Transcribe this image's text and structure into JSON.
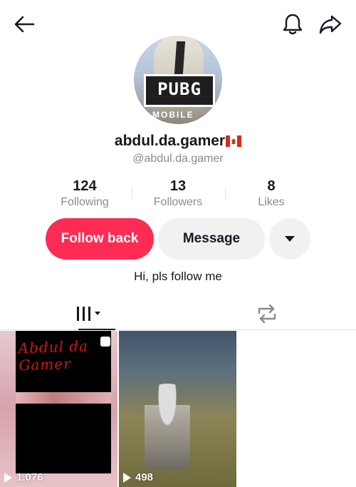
{
  "header": {
    "back_icon": "arrow-left-icon",
    "bell_icon": "bell-icon",
    "share_icon": "share-arrow-icon"
  },
  "profile": {
    "avatar_logo_text": "PUBG",
    "avatar_logo_sub": "MOBILE",
    "username": "abdul.da.gamer",
    "flag_icon": "canada-flag-icon",
    "handle": "@abdul.da.gamer",
    "bio": "Hi, pls follow me"
  },
  "stats": [
    {
      "value": "124",
      "label": "Following"
    },
    {
      "value": "13",
      "label": "Followers"
    },
    {
      "value": "8",
      "label": "Likes"
    }
  ],
  "actions": {
    "follow_back": "Follow back",
    "message": "Message",
    "more_icon": "caret-down-icon"
  },
  "tabs": {
    "videos_icon": "grid-videos-icon",
    "repost_icon": "repost-icon"
  },
  "videos": [
    {
      "views": "1,076",
      "overlay_text": "Abdul da Gamer"
    },
    {
      "views": "498"
    }
  ],
  "colors": {
    "accent": "#fe2c55",
    "secondary_button": "#f1f1f2",
    "muted_text": "#8a8b91"
  }
}
